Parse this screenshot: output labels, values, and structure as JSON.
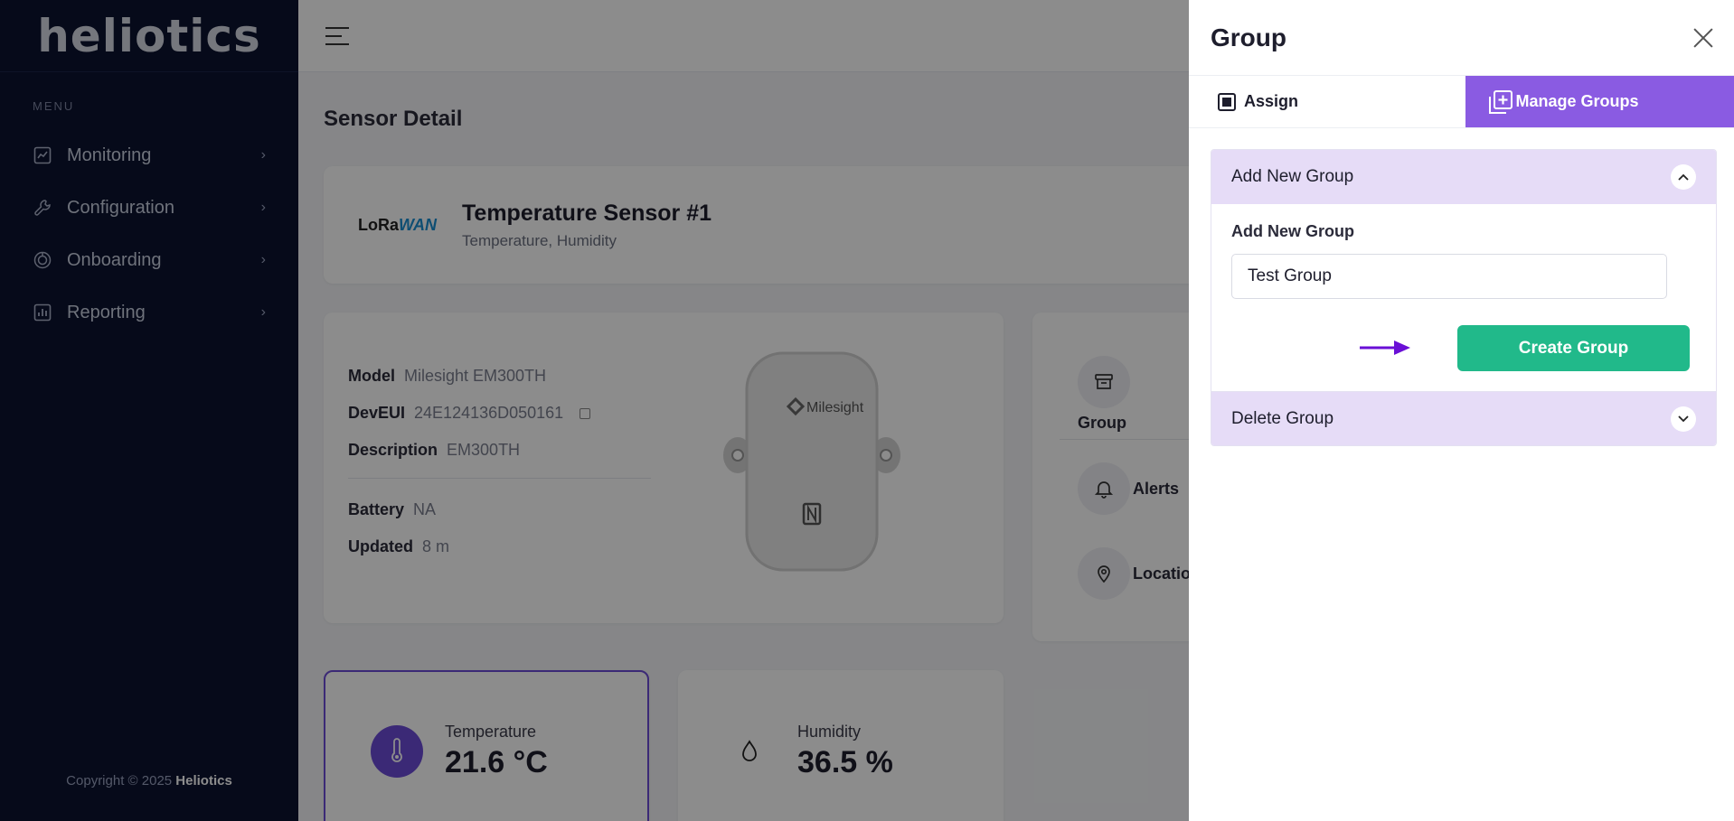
{
  "brand": {
    "name": "heliotics"
  },
  "sidebar": {
    "menu_label": "MENU",
    "items": [
      {
        "label": "Monitoring",
        "icon": "chart-line-icon"
      },
      {
        "label": "Configuration",
        "icon": "wrench-icon"
      },
      {
        "label": "Onboarding",
        "icon": "onboarding-icon"
      },
      {
        "label": "Reporting",
        "icon": "bar-chart-icon"
      }
    ],
    "copyright_prefix": "Copyright © 2025 ",
    "copyright_brand": "Heliotics"
  },
  "page": {
    "title": "Sensor Detail"
  },
  "sensor": {
    "protocol_logo_a": "LoRa",
    "protocol_logo_b": "WAN",
    "name": "Temperature Sensor #1",
    "subtitle": "Temperature, Humidity",
    "model_label": "Model",
    "model": "Milesight EM300TH",
    "deveui_label": "DevEUI",
    "deveui": "24E124136D050161",
    "description_label": "Description",
    "description": "EM300TH",
    "battery_label": "Battery",
    "battery": "NA",
    "updated_label": "Updated",
    "updated": "8 m",
    "device_brand": "Milesight"
  },
  "side_panel": {
    "group": "Group",
    "alerts": "Alerts",
    "location": "Locatio"
  },
  "metrics": {
    "temperature_label": "Temperature",
    "temperature_value": "21.6 °C",
    "humidity_label": "Humidity",
    "humidity_value": "36.5 %"
  },
  "drawer": {
    "title": "Group",
    "tabs": {
      "assign": "Assign",
      "manage": "Manage Groups"
    },
    "add_section": {
      "header": "Add New Group",
      "field_label": "Add New Group",
      "input_value": "Test Group",
      "button": "Create Group"
    },
    "delete_section": {
      "header": "Delete Group"
    }
  },
  "colors": {
    "sidebar_bg": "#0b1330",
    "accent_purple": "#8a5be2",
    "accordion_bg": "#e6dcf7",
    "create_button": "#21b98a",
    "arrow": "#6a0fd6"
  }
}
